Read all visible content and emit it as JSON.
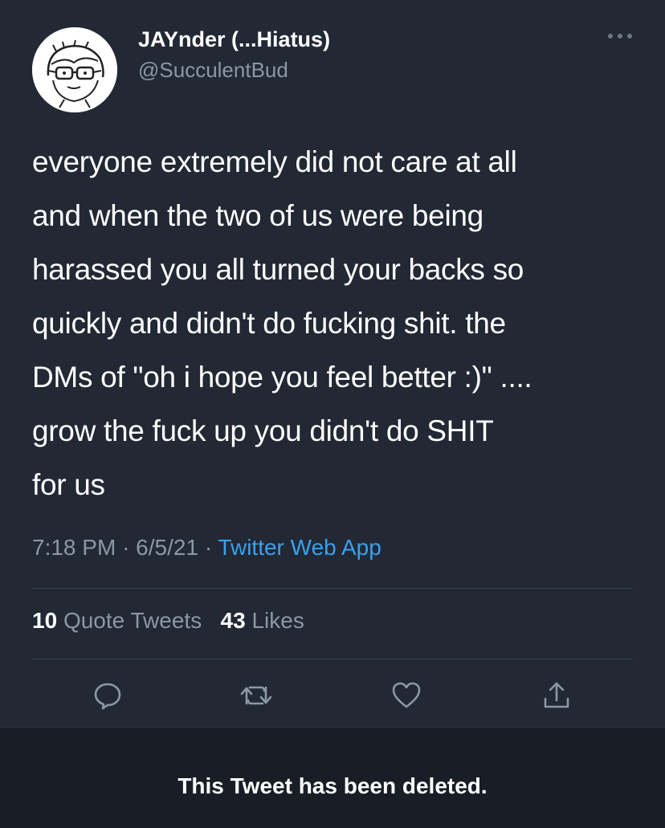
{
  "author": {
    "display_name": "JAYnder (...Hiatus)",
    "handle": "@SucculentBud",
    "avatar_icon": "cartoon-face-with-glasses-avatar"
  },
  "tweet": {
    "text": "everyone extremely did not care at all\nand when the two of us were being\nharassed you all turned your backs so\nquickly and didn't do fucking shit. the\nDMs of \"oh i hope you feel better :)\" ....\ngrow the fuck up you didn't do SHIT\nfor us",
    "time": "7:18 PM",
    "date": "6/5/21",
    "separator": "·",
    "source": "Twitter Web App"
  },
  "stats": {
    "quote_tweets_count": "10",
    "quote_tweets_label": "Quote Tweets",
    "likes_count": "43",
    "likes_label": "Likes"
  },
  "actions": [
    "reply-icon",
    "retweet-icon",
    "like-icon",
    "share-icon"
  ],
  "banner": {
    "text": "This Tweet has been deleted."
  },
  "colors": {
    "background": "#222834",
    "secondary_text": "#8b98a5",
    "link": "#3aa0ee",
    "banner_background": "#191e26"
  }
}
